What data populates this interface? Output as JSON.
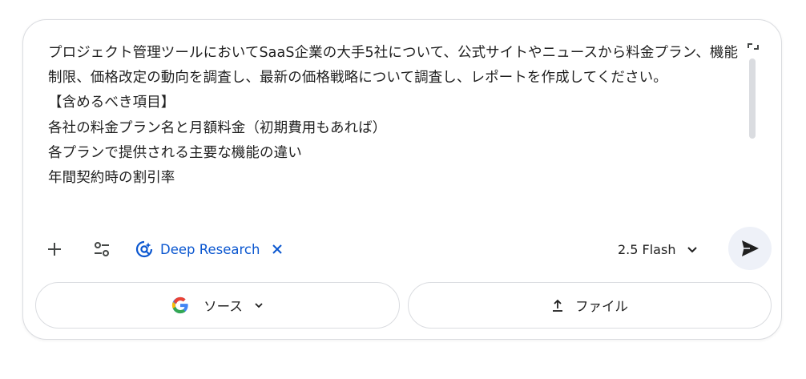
{
  "prompt": {
    "text": "プロジェクト管理ツールにおいてSaaS企業の大手5社について、公式サイトやニュースから料金プラン、機能制限、価格改定の動向を調査し、最新の価格戦略について調査し、レポートを作成してください。\n【含めるべき項目】\n各社の料金プラン名と月額料金（初期費用もあれば）\n各プランで提供される主要な機能の違い\n年間契約時の割引率"
  },
  "toolbar": {
    "deep_research_label": "Deep Research",
    "model_label": "2.5 Flash"
  },
  "bottom": {
    "source_label": "ソース",
    "file_label": "ファイル"
  },
  "colors": {
    "accent": "#0b57d0",
    "border": "#dadce0",
    "send_bg": "#eef1f8",
    "text": "#1f1f1f"
  },
  "icons": [
    "expand-icon",
    "plus-icon",
    "tools-icon",
    "deep-research-icon",
    "close-icon",
    "chevron-down-icon",
    "send-icon",
    "google-icon",
    "upload-icon"
  ]
}
